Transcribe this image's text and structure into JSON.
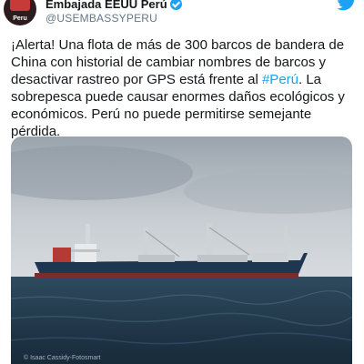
{
  "tweet": {
    "avatar_text": "Peru",
    "display_name": "Embajada EEUU Perú",
    "handle": "@USEMBASSYPERU",
    "text_before": "¡Alerta! Una flota de más de 300 barcos de bandera de China con historial de cambiar nombres de barcos y desactivar rastreo por GPS está frente al ",
    "hashtag": "#Perú",
    "text_after": ". La sobrepesca puede causar enormes daños ecológicos y económicos. Perú no puede permitirse semejante pérdida."
  },
  "media": {
    "credit": "© Isaac Cassidy-Fotosmart"
  },
  "icons": {
    "verified": "verified-badge-icon",
    "brand": "twitter-bird-icon"
  },
  "colors": {
    "accent": "#1da1f2",
    "text": "#14171a",
    "muted": "#657786"
  }
}
